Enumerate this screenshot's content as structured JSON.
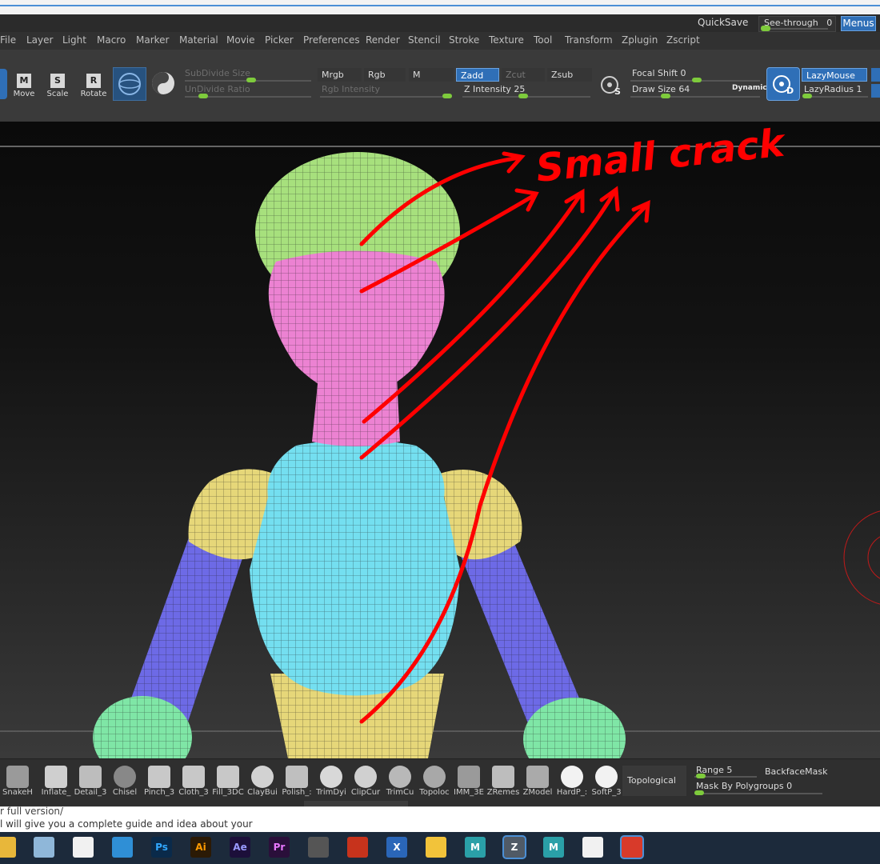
{
  "topbar": {
    "quicksave_label": "QuickSave",
    "seethrough_label": "See-through",
    "seethrough_value": "0",
    "menus_label": "Menus"
  },
  "menubar": {
    "items": [
      "File",
      "Layer",
      "Light",
      "Macro",
      "Marker",
      "Material",
      "Movie",
      "Picker",
      "Preferences",
      "Render",
      "Stencil",
      "Stroke",
      "Texture",
      "Tool",
      "Transform",
      "Zplugin",
      "Zscript"
    ]
  },
  "shelf": {
    "tools": [
      {
        "key": "M",
        "label": "Move"
      },
      {
        "key": "S",
        "label": "Scale"
      },
      {
        "key": "R",
        "label": "Rotate"
      }
    ],
    "subdivide_size_label": "SubDivide Size",
    "undivide_ratio_label": "UnDivide Ratio",
    "mrgb_label": "Mrgb",
    "rgb_label": "Rgb",
    "m_label": "M",
    "rgb_intensity_label": "Rgb Intensity",
    "zadd_label": "Zadd",
    "zcut_label": "Zcut",
    "zsub_label": "Zsub",
    "z_intensity_label": "Z Intensity",
    "z_intensity_value": "25",
    "focal_shift_label": "Focal Shift",
    "focal_shift_value": "0",
    "draw_size_label": "Draw Size",
    "draw_size_value": "64",
    "dynamic_label": "Dynamic",
    "lazymouse_label": "LazyMouse",
    "lazyradius_label": "LazyRadius",
    "lazyradius_value": "1",
    "s_glyph": "S",
    "d_glyph": "D"
  },
  "annotation": {
    "text": "Small crack",
    "color": "#ff0000"
  },
  "brushbar": {
    "brushes": [
      "SnakeH",
      "Inflate_",
      "Detail_3",
      "Chisel",
      "Pinch_3",
      "Cloth_3",
      "Fill_3DC",
      "ClayBui",
      "Polish_:",
      "TrimDyi",
      "ClipCur",
      "TrimCu",
      "Topoloc",
      "IMM_3E",
      "ZRemes",
      "ZModel",
      "HardP_:",
      "SoftP_3"
    ],
    "topological_label": "Topological",
    "range_label": "Range",
    "range_value": "5",
    "backfacemask_label": "BackfaceMask",
    "mask_by_polygroups_label": "Mask By Polygroups",
    "mask_by_polygroups_value": "0"
  },
  "caption": {
    "line1": "r full version/",
    "line2": "l will give you a complete guide and idea about your"
  },
  "taskbar": {
    "icons": [
      {
        "name": "file-explorer-icon",
        "glyph": "",
        "color": "#e8b73a"
      },
      {
        "name": "app-icon",
        "glyph": "",
        "color": "#8fb7d9"
      },
      {
        "name": "store-icon",
        "glyph": "",
        "color": "#f1f1f1"
      },
      {
        "name": "photo-app-icon",
        "glyph": "",
        "color": "#2f8fd6"
      },
      {
        "name": "photoshop-icon",
        "glyph": "Ps",
        "color": "#0a2a4a"
      },
      {
        "name": "illustrator-icon",
        "glyph": "Ai",
        "color": "#2b1a05"
      },
      {
        "name": "after-effects-icon",
        "glyph": "Ae",
        "color": "#1c0f3a"
      },
      {
        "name": "premiere-icon",
        "glyph": "Pr",
        "color": "#2a0f3a"
      },
      {
        "name": "spiral-app-icon",
        "glyph": "",
        "color": "#555"
      },
      {
        "name": "maple-app-icon",
        "glyph": "",
        "color": "#c7331c"
      },
      {
        "name": "x-app-icon",
        "glyph": "X",
        "color": "#2a66b8"
      },
      {
        "name": "nuke-icon",
        "glyph": "",
        "color": "#f2c33a"
      },
      {
        "name": "maya-icon",
        "glyph": "M",
        "color": "#2aa0a8"
      },
      {
        "name": "zbrush-icon",
        "glyph": "Z",
        "color": "#505a66"
      },
      {
        "name": "maya-icon-2",
        "glyph": "M",
        "color": "#2aa0a8"
      },
      {
        "name": "mail-icon",
        "glyph": "",
        "color": "#f1f1f1"
      },
      {
        "name": "photo-booth-icon",
        "glyph": "",
        "color": "#d83a2a"
      }
    ]
  }
}
